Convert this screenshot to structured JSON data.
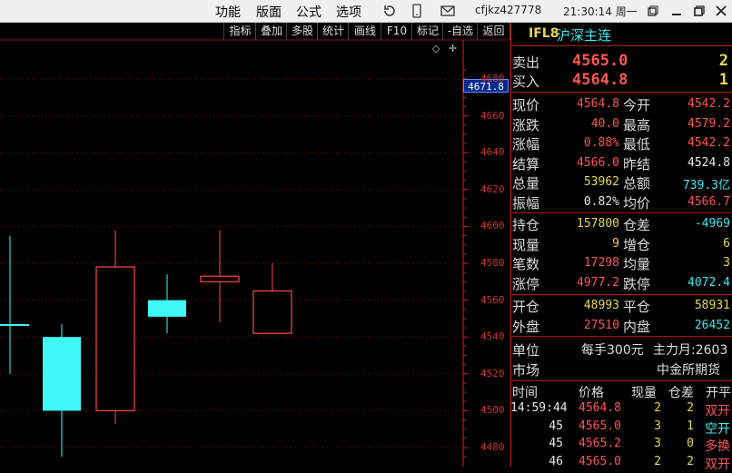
{
  "menu": [
    "功能",
    "版面",
    "公式",
    "选项"
  ],
  "user": "cfjkz427778",
  "clock": "21:30:14 周一",
  "toolbar": [
    "指标",
    "叠加",
    "多股",
    "统计",
    "画线",
    "F10",
    "标记",
    "-自选",
    "返回"
  ],
  "chart": {
    "current_price_tag": "4671.8",
    "axis_labels": [
      "4680",
      "4660",
      "4640",
      "4620",
      "4600",
      "4580",
      "4560",
      "4540",
      "4520",
      "4500",
      "4480"
    ]
  },
  "chart_data": {
    "type": "candlestick",
    "title": "",
    "ylim": [
      4470,
      4690
    ],
    "candles": [
      {
        "open": 4547,
        "close": 4547,
        "high": 4595,
        "low": 4520,
        "color": "cyan"
      },
      {
        "open": 4540,
        "close": 4500,
        "high": 4547,
        "low": 4475,
        "color": "cyan"
      },
      {
        "open": 4500,
        "close": 4578,
        "high": 4598,
        "low": 4493,
        "color": "red"
      },
      {
        "open": 4560,
        "close": 4551,
        "high": 4574,
        "low": 4542,
        "color": "cyan"
      },
      {
        "open": 4570,
        "close": 4573,
        "high": 4598,
        "low": 4548,
        "color": "red"
      },
      {
        "open": 4542,
        "close": 4565,
        "high": 4580,
        "low": 4542,
        "color": "red"
      }
    ]
  },
  "quote": {
    "code": "IFL8",
    "name": "沪深主连",
    "sell_label": "卖出",
    "sell_price": "4565.0",
    "sell_vol": "2",
    "buy_label": "买入",
    "buy_price": "4564.8",
    "buy_vol": "1",
    "rows1": [
      {
        "l1": "现价",
        "v1": "4564.8",
        "c1": "red",
        "l2": "今开",
        "v2": "4542.2",
        "c2": "red"
      },
      {
        "l1": "涨跌",
        "v1": "40.0",
        "c1": "red",
        "l2": "最高",
        "v2": "4579.2",
        "c2": "red"
      },
      {
        "l1": "涨幅",
        "v1": "0.88%",
        "c1": "red",
        "l2": "最低",
        "v2": "4542.2",
        "c2": "red"
      },
      {
        "l1": "结算",
        "v1": "4566.0",
        "c1": "red",
        "l2": "昨结",
        "v2": "4524.8",
        "c2": "wht"
      },
      {
        "l1": "总量",
        "v1": "53962",
        "c1": "yel",
        "l2": "总额",
        "v2": "739.3亿",
        "c2": "cyn"
      },
      {
        "l1": "振幅",
        "v1": "0.82%",
        "c1": "wht",
        "l2": "均价",
        "v2": "4566.7",
        "c2": "red"
      }
    ],
    "rows2": [
      {
        "l1": "持仓",
        "v1": "157800",
        "c1": "yel",
        "l2": "仓差",
        "v2": "-4969",
        "c2": "cyn"
      },
      {
        "l1": "现量",
        "v1": "9",
        "c1": "yel",
        "l2": "增仓",
        "v2": "6",
        "c2": "yel"
      },
      {
        "l1": "笔数",
        "v1": "17298",
        "c1": "red",
        "l2": "均量",
        "v2": "3",
        "c2": "yel"
      },
      {
        "l1": "涨停",
        "v1": "4977.2",
        "c1": "red",
        "l2": "跌停",
        "v2": "4072.4",
        "c2": "cyn"
      }
    ],
    "rows3": [
      {
        "l1": "开仓",
        "v1": "48993",
        "c1": "yel",
        "l2": "平仓",
        "v2": "58931",
        "c2": "yel"
      },
      {
        "l1": "外盘",
        "v1": "27510",
        "c1": "red",
        "l2": "内盘",
        "v2": "26452",
        "c2": "cyn"
      }
    ],
    "unit_label": "单位",
    "unit_value": "每手300元",
    "main_label": "主力月:2603",
    "market_label": "市场",
    "market_value": "中金所期货"
  },
  "ticks": {
    "headers": [
      "时间",
      "价格",
      "现量",
      "仓差",
      "开平"
    ],
    "rows": [
      {
        "time": "14:59:44",
        "price": "4564.8",
        "vol": "2",
        "oi": "2",
        "type": "双开",
        "tc": "red"
      },
      {
        "time": "45",
        "price": "4565.0",
        "vol": "3",
        "oi": "1",
        "type": "空开",
        "tc": "cyn"
      },
      {
        "time": "45",
        "price": "4565.2",
        "vol": "3",
        "oi": "0",
        "type": "多换",
        "tc": "red"
      },
      {
        "time": "46",
        "price": "4565.0",
        "vol": "2",
        "oi": "2",
        "type": "双开",
        "tc": "red"
      }
    ]
  }
}
